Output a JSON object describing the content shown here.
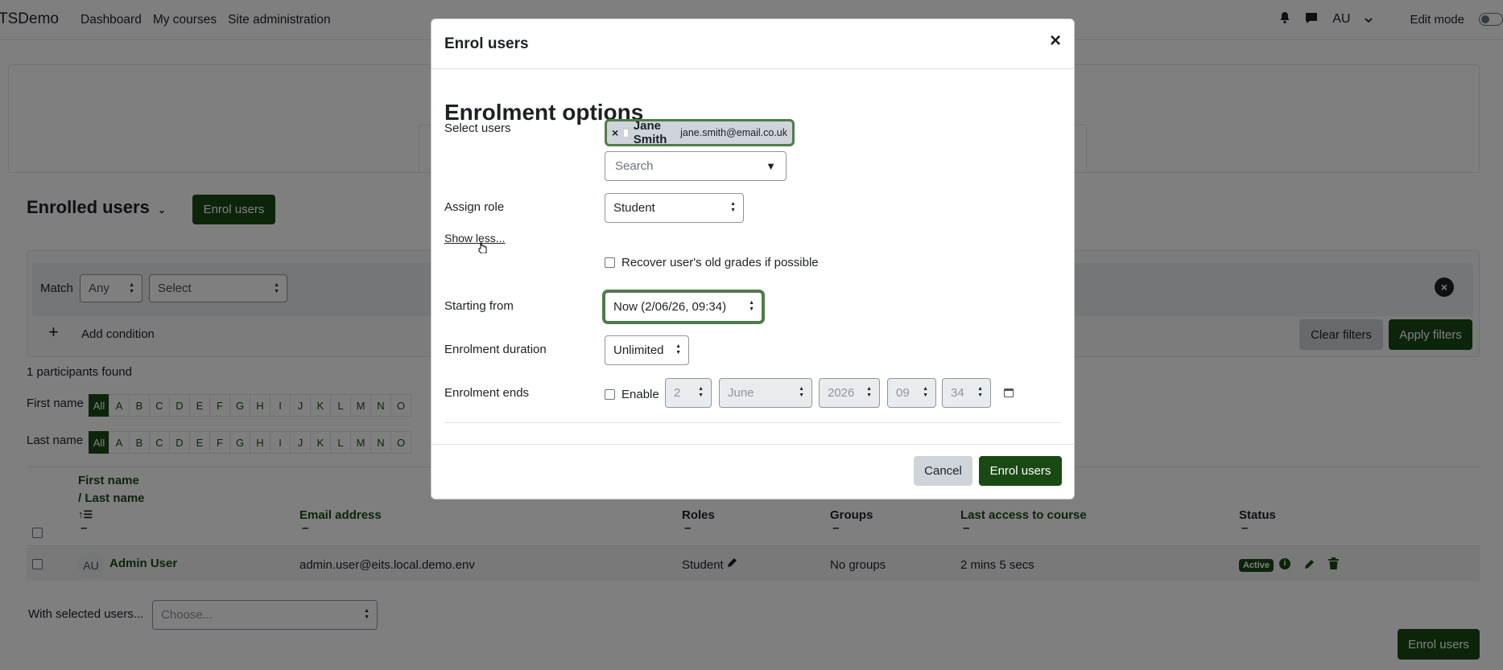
{
  "navbar": {
    "brand": "TSDemo",
    "links": [
      "Dashboard",
      "My courses",
      "Site administration"
    ],
    "user_initials": "AU",
    "edit_mode_label": "Edit mode"
  },
  "page": {
    "title": "Enrolled users",
    "enrol_button": "Enrol users",
    "filter": {
      "match_label": "Match",
      "match_value": "Any",
      "select_value": "Select",
      "add_condition": "Add condition",
      "clear_filters": "Clear filters",
      "apply_filters": "Apply filters"
    },
    "participants_found": "1 participants found",
    "first_name_label": "First name",
    "last_name_label": "Last name",
    "alphabet": [
      "All",
      "A",
      "B",
      "C",
      "D",
      "E",
      "F",
      "G",
      "H",
      "I",
      "J",
      "K",
      "L",
      "M",
      "N",
      "O"
    ],
    "table": {
      "headers": {
        "name_line1": "First name",
        "name_line2": "/ Last name",
        "email": "Email address",
        "roles": "Roles",
        "groups": "Groups",
        "last_access": "Last access to course",
        "status": "Status"
      },
      "row": {
        "initials": "AU",
        "name": "Admin User",
        "email": "admin.user@eits.local.demo.env",
        "role": "Student",
        "groups": "No groups",
        "last_access": "2 mins 5 secs",
        "status": "Active"
      }
    },
    "with_selected_label": "With selected users...",
    "with_selected_value": "Choose...",
    "bottom_enrol_button": "Enrol users"
  },
  "modal": {
    "title": "Enrol users",
    "close_symbol": "×",
    "heading": "Enrolment options",
    "select_users_label": "Select users",
    "selected_user": {
      "remove_symbol": "×",
      "name": "Jane Smith",
      "email": "jane.smith@email.co.uk"
    },
    "search_placeholder": "Search",
    "assign_role_label": "Assign role",
    "assign_role_value": "Student",
    "show_less": "Show less...",
    "recover_grades_label": "Recover user's old grades if possible",
    "starting_from_label": "Starting from",
    "starting_from_value": "Now (2/06/26, 09:34)",
    "duration_label": "Enrolment duration",
    "duration_value": "Unlimited",
    "ends_label": "Enrolment ends",
    "enable_label": "Enable",
    "ends_day": "2",
    "ends_month": "June",
    "ends_year": "2026",
    "ends_hour": "09",
    "ends_minute": "34",
    "cancel_button": "Cancel",
    "submit_button": "Enrol users"
  },
  "colors": {
    "brand_green": "#194a14",
    "focus_green": "#4f7c4a"
  }
}
